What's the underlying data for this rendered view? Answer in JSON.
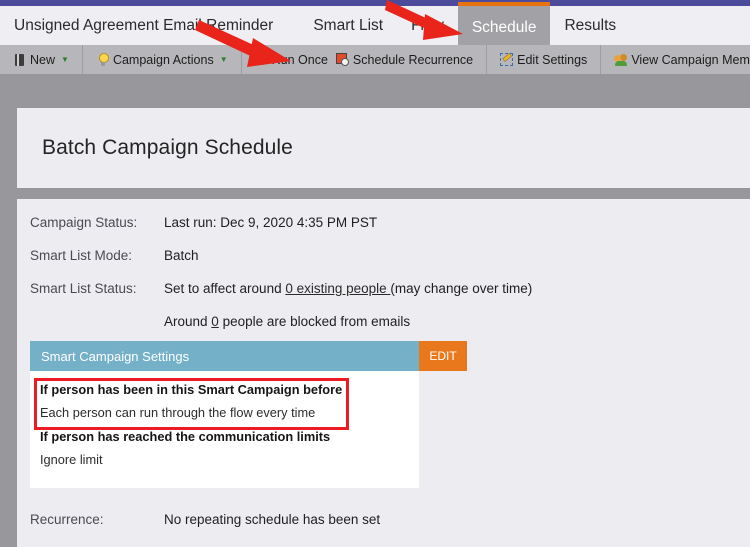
{
  "tabs": [
    {
      "label": "Unsigned Agreement Email Reminder",
      "active": false
    },
    {
      "label": "Smart List",
      "active": false
    },
    {
      "label": "Flow",
      "active": false
    },
    {
      "label": "Schedule",
      "active": true
    },
    {
      "label": "Results",
      "active": false
    }
  ],
  "toolbar": {
    "groups": [
      {
        "items": [
          {
            "label": "New",
            "icon": "new-document-icon",
            "dropdown": true
          }
        ]
      },
      {
        "items": [
          {
            "label": "Campaign Actions",
            "icon": "lightbulb-icon",
            "dropdown": true
          }
        ]
      },
      {
        "items": [
          {
            "label": "Run Once",
            "icon": "play-circle-icon",
            "dropdown": false
          },
          {
            "label": "Schedule Recurrence",
            "icon": "calendar-clock-icon",
            "dropdown": false
          }
        ]
      },
      {
        "items": [
          {
            "label": "Edit Settings",
            "icon": "pencil-icon",
            "dropdown": false
          }
        ]
      },
      {
        "items": [
          {
            "label": "View Campaign Members",
            "icon": "people-icon",
            "dropdown": false
          }
        ]
      }
    ]
  },
  "page": {
    "title": "Batch Campaign Schedule"
  },
  "details": {
    "campaign_status_label": "Campaign Status:",
    "campaign_status_value": "Last run: Dec 9, 2020 4:35 PM PST",
    "smart_list_mode_label": "Smart List Mode:",
    "smart_list_mode_value": "Batch",
    "smart_list_status_label": "Smart List Status:",
    "smart_list_status_prefix": "Set to affect around ",
    "smart_list_status_link": "0 existing people ",
    "smart_list_status_suffix": "(may change over time)",
    "blocked_prefix": "Around ",
    "blocked_link": "0",
    "blocked_suffix": " people are blocked from emails",
    "recurrence_label": "Recurrence:",
    "recurrence_value": "No repeating schedule has been set"
  },
  "settings_card": {
    "header_title": "Smart Campaign Settings",
    "edit_label": "EDIT",
    "rows": [
      {
        "head": "If person has been in this Smart Campaign before",
        "value": "Each person can run through the flow every time",
        "highlighted": true
      },
      {
        "head": "If person has reached the communication limits",
        "value": "Ignore limit",
        "highlighted": false
      }
    ]
  },
  "annotations": [
    {
      "name": "arrow-to-schedule-recurrence",
      "target": "Schedule Recurrence"
    },
    {
      "name": "arrow-to-schedule-tab",
      "target": "Schedule"
    }
  ],
  "colors": {
    "top_strip": "#4b4a9b",
    "page_background": "#97979c",
    "tab_bar": "#eeeef3",
    "active_tab_bg": "#a2a2a6",
    "active_tab_border": "#e8730e",
    "toolbar": "#b7b7bb",
    "panel": "#ececf1",
    "settings_header": "#74b1c9",
    "edit_button": "#e8781b",
    "annotation_red": "#ec1c24",
    "highlight_border": "#ec1c24"
  }
}
